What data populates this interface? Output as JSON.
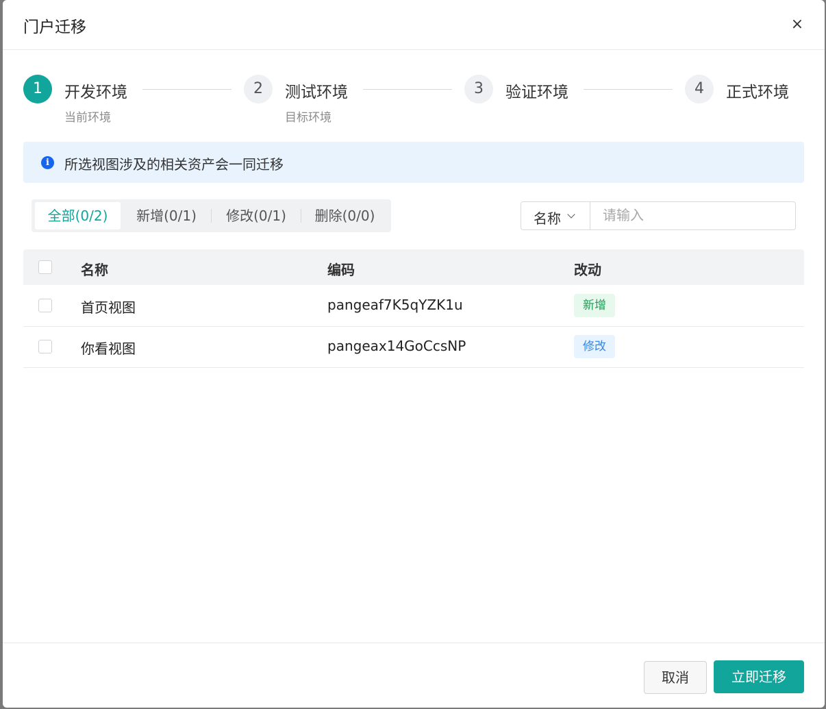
{
  "dialog": {
    "title": "门户迁移",
    "close_icon": "×"
  },
  "steps": [
    {
      "number": "1",
      "title": "开发环境",
      "subtitle": "当前环境",
      "active": true
    },
    {
      "number": "2",
      "title": "测试环境",
      "subtitle": "目标环境",
      "active": false
    },
    {
      "number": "3",
      "title": "验证环境",
      "subtitle": "",
      "active": false
    },
    {
      "number": "4",
      "title": "正式环境",
      "subtitle": "",
      "active": false
    }
  ],
  "alert": {
    "icon": "info-icon",
    "icon_glyph": "i",
    "text": "所选视图涉及的相关资产会一同迁移"
  },
  "filter_tabs": [
    {
      "label": "全部(0/2)",
      "active": true
    },
    {
      "label": "新增(0/1)",
      "active": false
    },
    {
      "label": "修改(0/1)",
      "active": false
    },
    {
      "label": "删除(0/0)",
      "active": false
    }
  ],
  "search": {
    "field_label": "名称",
    "placeholder": "请输入",
    "value": ""
  },
  "table": {
    "columns": [
      "名称",
      "编码",
      "改动"
    ],
    "rows": [
      {
        "name": "首页视图",
        "code": "pangeaf7K5qYZK1u",
        "change": "新增"
      },
      {
        "name": "你看视图",
        "code": "pangeax14GoCcsNP",
        "change": "修改"
      }
    ]
  },
  "colors": {
    "primary": "#12a59b",
    "tag_new_bg": "#e6f9ec",
    "tag_new_text": "#1f9d55",
    "tag_modify_bg": "#e7f3fe",
    "tag_modify_text": "#3a86e0"
  },
  "footer": {
    "cancel_label": "取消",
    "confirm_label": "立即迁移"
  }
}
